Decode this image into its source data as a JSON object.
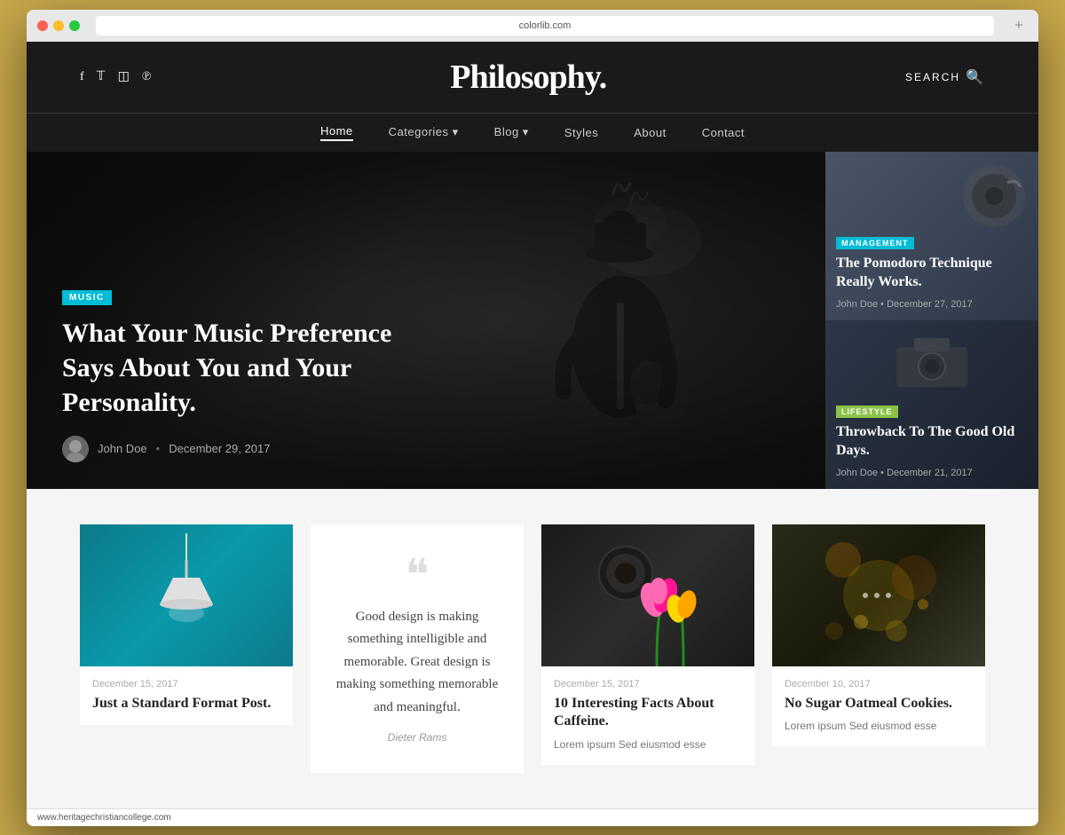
{
  "browser": {
    "address": "colorlib.com",
    "new_tab_label": "+"
  },
  "site": {
    "title": "Philosophy.",
    "search_label": "SEARCH",
    "url_status": "www.heritagechristiancollege.com"
  },
  "social": {
    "icons": [
      "f",
      "𝕏",
      "✦",
      "⊕"
    ]
  },
  "nav": {
    "items": [
      {
        "label": "Home",
        "active": true
      },
      {
        "label": "Categories",
        "dropdown": true
      },
      {
        "label": "Blog",
        "dropdown": true
      },
      {
        "label": "Styles"
      },
      {
        "label": "About"
      },
      {
        "label": "Contact"
      }
    ]
  },
  "hero": {
    "badge": "MUSIC",
    "title": "What Your Music Preference Says About You and Your Personality.",
    "author": "John Doe",
    "date": "December 29, 2017"
  },
  "hero_cards": [
    {
      "badge": "MANAGEMENT",
      "badge_class": "badge-management",
      "title": "The Pomodoro Technique Really Works.",
      "author": "John Doe",
      "date": "December 27, 2017"
    },
    {
      "badge": "LIFESTYLE",
      "badge_class": "badge-lifestyle",
      "title": "Throwback To The Good Old Days.",
      "author": "John Doe",
      "date": "December 21, 2017"
    }
  ],
  "posts": [
    {
      "type": "image",
      "img_type": "lamp",
      "date": "December 15, 2017",
      "title": "Just a Standard Format Post."
    },
    {
      "type": "quote",
      "quote_mark": "❝",
      "quote_text": "Good design is making something intelligible and memorable. Great design is making something memorable and meaningful.",
      "quote_author": "Dieter Rams"
    },
    {
      "type": "image",
      "img_type": "coffee",
      "date": "December 15, 2017",
      "title": "10 Interesting Facts About Caffeine.",
      "excerpt": "Lorem ipsum Sed eiusmod esse"
    },
    {
      "type": "image",
      "img_type": "oatmeal",
      "date": "December 10, 2017",
      "title": "No Sugar Oatmeal Cookies.",
      "excerpt": "Lorem ipsum Sed eiusmod esse"
    }
  ]
}
